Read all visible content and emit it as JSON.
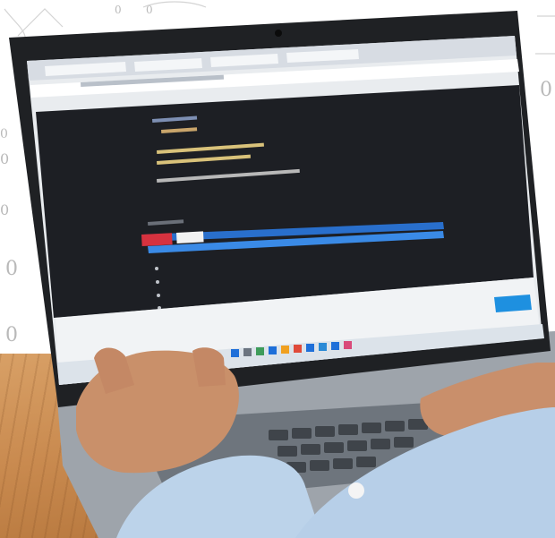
{
  "background": {
    "doodle_digits": [
      "0",
      "0",
      "0",
      "0",
      "0",
      "0",
      "0",
      "0"
    ]
  },
  "colors": {
    "editor_bg": "#1d1f24",
    "selection_blue": "#2a74d6",
    "run_red": "#d6323f",
    "accent_button": "#1e90e0",
    "desk_wood": "#c98a4f",
    "sleeve": "#bcd3ea"
  },
  "icons": [
    "camera-icon",
    "windows-start-icon",
    "taskbar-app-icon"
  ]
}
